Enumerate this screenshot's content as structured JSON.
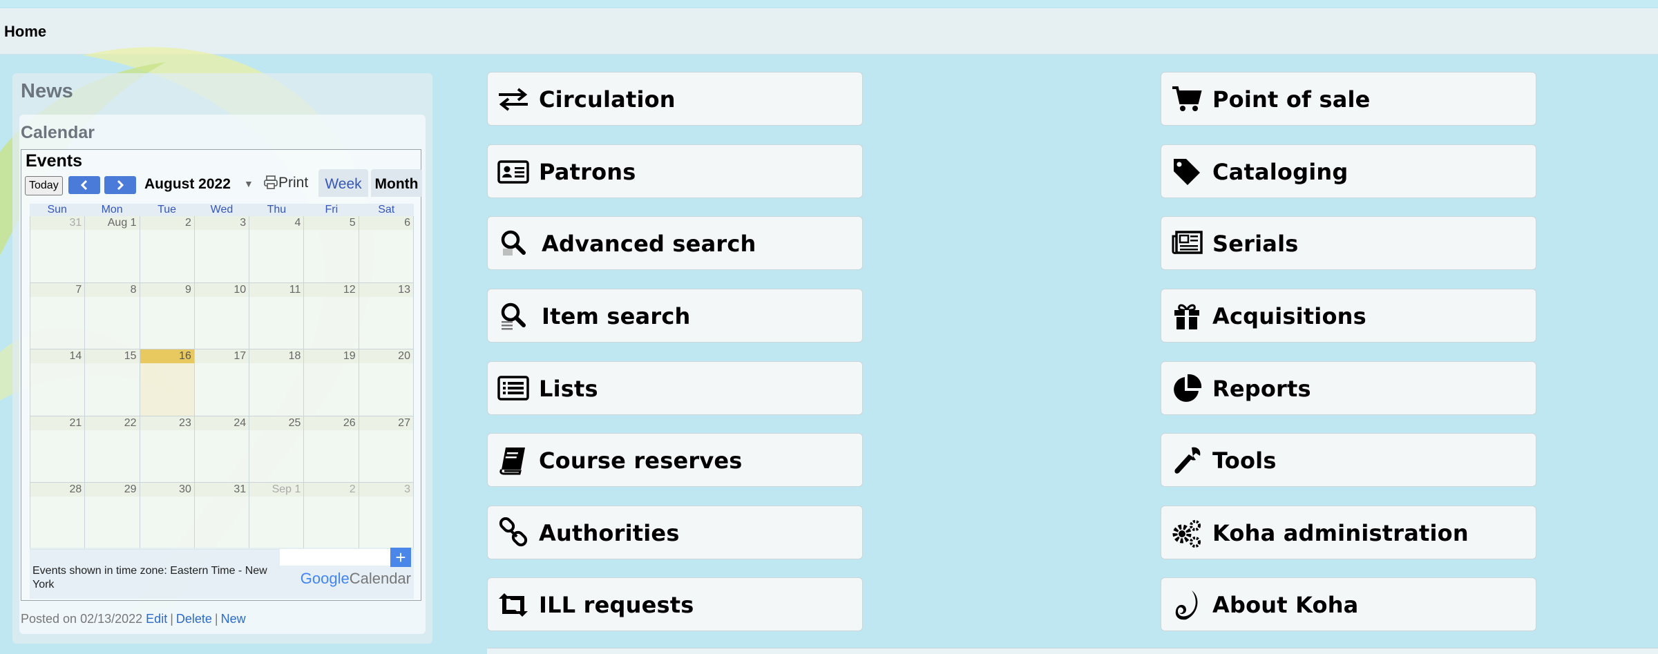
{
  "breadcrumb": {
    "home": "Home"
  },
  "news": {
    "title": "News",
    "item_title": "Calendar",
    "calendar": {
      "events_title": "Events",
      "today": "Today",
      "month_label": "August 2022",
      "print": "Print",
      "week_tab": "Week",
      "month_tab": "Month",
      "days_of_week": [
        "Sun",
        "Mon",
        "Tue",
        "Wed",
        "Thu",
        "Fri",
        "Sat"
      ],
      "weeks": [
        [
          "31",
          "Aug 1",
          "2",
          "3",
          "4",
          "5",
          "6"
        ],
        [
          "7",
          "8",
          "9",
          "10",
          "11",
          "12",
          "13"
        ],
        [
          "14",
          "15",
          "16",
          "17",
          "18",
          "19",
          "20"
        ],
        [
          "21",
          "22",
          "23",
          "24",
          "25",
          "26",
          "27"
        ],
        [
          "28",
          "29",
          "30",
          "31",
          "Sep 1",
          "2",
          "3"
        ]
      ],
      "timezone_text": "Events shown in time zone: Eastern Time - New York",
      "google": "Google",
      "calendar_word": "Calendar",
      "add": "+"
    },
    "posted_on": "Posted on 02/13/2022",
    "edit": "Edit",
    "delete": "Delete",
    "new": "New"
  },
  "modules_left": [
    {
      "label": "Circulation",
      "icon": "exchange-arrows-icon"
    },
    {
      "label": "Patrons",
      "icon": "id-card-icon"
    },
    {
      "label": "Advanced search",
      "icon": "magnifier-icon"
    },
    {
      "label": "Item search",
      "icon": "magnifier-list-icon"
    },
    {
      "label": "Lists",
      "icon": "list-icon"
    },
    {
      "label": "Course reserves",
      "icon": "book-icon"
    },
    {
      "label": "Authorities",
      "icon": "link-icon"
    },
    {
      "label": "ILL requests",
      "icon": "retweet-icon"
    }
  ],
  "modules_right": [
    {
      "label": "Point of sale",
      "icon": "shopping-cart-icon"
    },
    {
      "label": "Cataloging",
      "icon": "tag-icon"
    },
    {
      "label": "Serials",
      "icon": "newspaper-icon"
    },
    {
      "label": "Acquisitions",
      "icon": "gift-icon"
    },
    {
      "label": "Reports",
      "icon": "pie-chart-icon"
    },
    {
      "label": "Tools",
      "icon": "wrench-icon"
    },
    {
      "label": "Koha administration",
      "icon": "gears-icon"
    },
    {
      "label": "About Koha",
      "icon": "koha-logo-icon"
    }
  ],
  "colors": {
    "background": "#bfe7f1",
    "button": "#f3f7f8",
    "link": "#2b6ac9",
    "today": "#e8c95f"
  }
}
